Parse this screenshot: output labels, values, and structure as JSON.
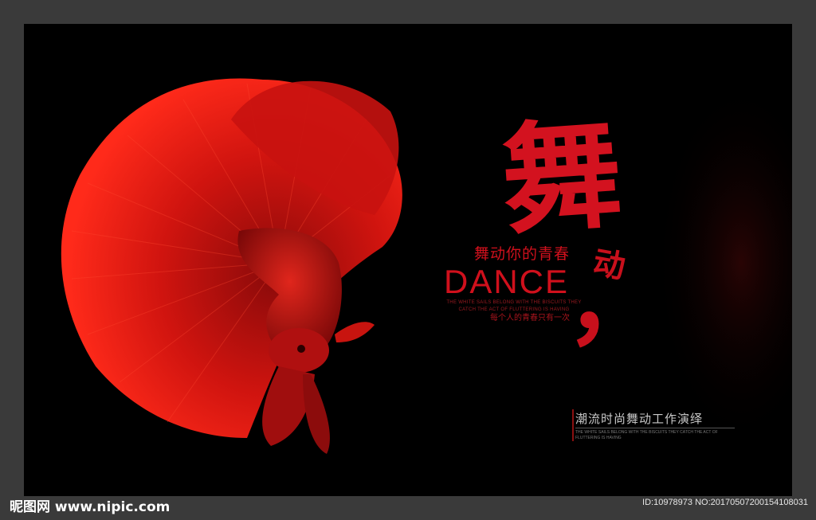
{
  "poster": {
    "calligraphy_main": "舞",
    "calligraphy_small": "动",
    "comma": "，",
    "subtitle": "舞动你的青春",
    "dance": "DANCE",
    "small_en": "THE WHITE SAILS BELONG WITH THE BISCUITS THEY CATCH THE ACT OF FLUTTERING IS HAVING",
    "small_cn": "每个人的青春只有一次",
    "bottom_cn": "潮流时尚舞动工作演绎",
    "bottom_en": "THE WHITE SAILS BELONG WITH THE BISCUITS THEY CATCH THE ACT OF FLUTTERING IS HAVING"
  },
  "watermark": {
    "site": "昵图网 www.nipic.com",
    "id_line": "ID:10978973 NO:20170507200154108031"
  },
  "colors": {
    "accent": "#d0101c",
    "background": "#000000",
    "frame": "#3a3a3a"
  }
}
